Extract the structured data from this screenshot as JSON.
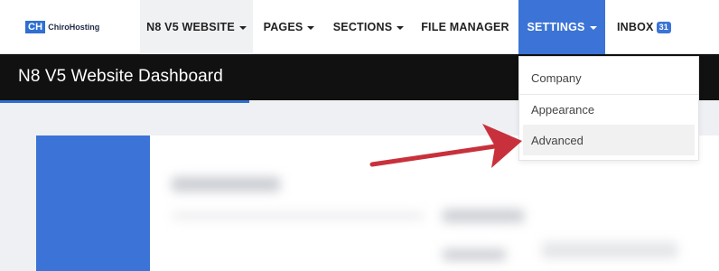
{
  "logo": {
    "mark": "CH",
    "text": "ChiroHosting"
  },
  "nav": {
    "website": "N8 V5 WEBSITE",
    "pages": "PAGES",
    "sections": "SECTIONS",
    "file_manager": "FILE MANAGER",
    "settings": "SETTINGS",
    "inbox": "INBOX",
    "inbox_count": "31"
  },
  "page": {
    "title": "N8 V5 Website Dashboard"
  },
  "settings_menu": {
    "items": [
      "Company",
      "Appearance",
      "Advanced"
    ],
    "highlighted": "Advanced"
  },
  "colors": {
    "accent": "#3b74d6",
    "titlebar": "#111111",
    "annotation_arrow": "#c8313b"
  },
  "icons": [
    "caret-down-icon",
    "annotation-arrow"
  ]
}
